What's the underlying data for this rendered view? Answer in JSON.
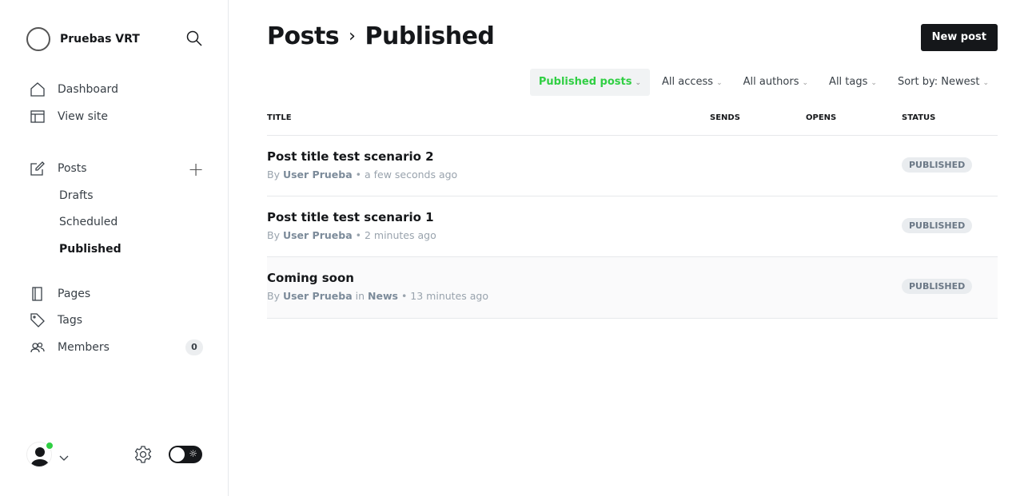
{
  "sidebar": {
    "site_name": "Pruebas VRT",
    "nav": [
      {
        "label": "Dashboard"
      },
      {
        "label": "View site"
      },
      {
        "label": "Posts"
      },
      {
        "label": "Pages"
      },
      {
        "label": "Tags"
      },
      {
        "label": "Members",
        "count": "0"
      }
    ],
    "sub": [
      "Drafts",
      "Scheduled",
      "Published"
    ]
  },
  "header": {
    "crumb": "Posts",
    "title": "Published",
    "new_post": "New post"
  },
  "filters": [
    "Published posts",
    "All access",
    "All authors",
    "All tags",
    "Sort by: Newest"
  ],
  "columns": {
    "title": "TITLE",
    "sends": "SENDS",
    "opens": "OPENS",
    "status": "STATUS"
  },
  "posts": [
    {
      "title": "Post title test scenario 2",
      "by": "By",
      "author": "User Prueba",
      "in": "",
      "tag": "",
      "time": "• a few seconds ago",
      "status": "PUBLISHED"
    },
    {
      "title": "Post title test scenario 1",
      "by": "By",
      "author": "User Prueba",
      "in": "",
      "tag": "",
      "time": "• 2 minutes ago",
      "status": "PUBLISHED"
    },
    {
      "title": "Coming soon",
      "by": "By",
      "author": "User Prueba",
      "in": "in",
      "tag": "News",
      "time": "• 13 minutes ago",
      "status": "PUBLISHED"
    }
  ],
  "colors": {
    "accent": "#30cf43",
    "dark": "#15171a"
  }
}
